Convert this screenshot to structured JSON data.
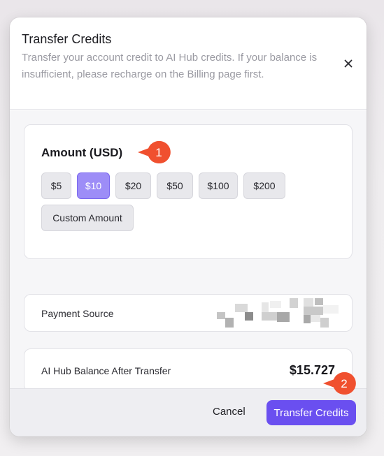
{
  "dialog": {
    "title": "Transfer Credits",
    "description": "Transfer your account credit to AI Hub credits. If your balance is insufficient, please recharge on the Billing page first.",
    "close_icon": "close-icon"
  },
  "amount": {
    "title": "Amount (USD)",
    "options": [
      "$5",
      "$10",
      "$20",
      "$50",
      "$100",
      "$200",
      "Custom Amount"
    ],
    "selected": "$10",
    "selected_color": "#9d8df7"
  },
  "payment_source": {
    "label": "Payment Source"
  },
  "balance": {
    "label": "AI Hub Balance After Transfer",
    "value": "$15.727"
  },
  "footer": {
    "cancel_label": "Cancel",
    "submit_label": "Transfer Credits",
    "accent_color": "#6a4ff0"
  },
  "markers": [
    "1",
    "2"
  ],
  "marker_color": "#f0502f"
}
